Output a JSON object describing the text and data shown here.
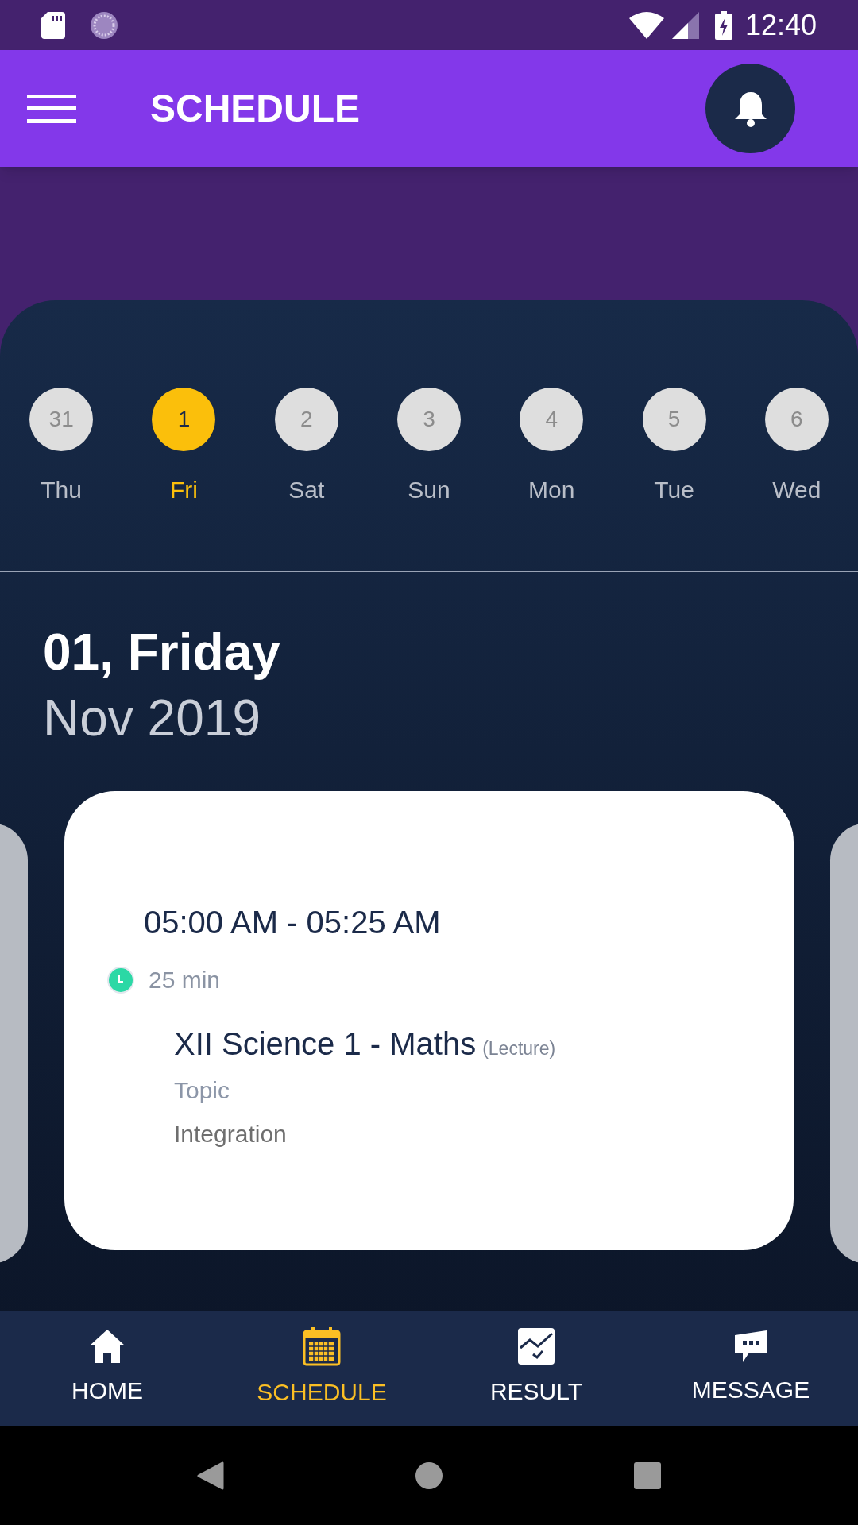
{
  "status_bar": {
    "time": "12:40"
  },
  "app_bar": {
    "title": "SCHEDULE"
  },
  "days": [
    {
      "number": "31",
      "weekday": "Thu",
      "selected": false
    },
    {
      "number": "1",
      "weekday": "Fri",
      "selected": true
    },
    {
      "number": "2",
      "weekday": "Sat",
      "selected": false
    },
    {
      "number": "3",
      "weekday": "Sun",
      "selected": false
    },
    {
      "number": "4",
      "weekday": "Mon",
      "selected": false
    },
    {
      "number": "5",
      "weekday": "Tue",
      "selected": false
    },
    {
      "number": "6",
      "weekday": "Wed",
      "selected": false
    }
  ],
  "date_heading": {
    "day": "01, Friday",
    "month_year": "Nov 2019"
  },
  "session": {
    "time_range": "05:00 AM - 05:25 AM",
    "duration": "25 min",
    "title": "XII Science 1 - Maths",
    "type": "(Lecture)",
    "topic_label": "Topic",
    "topic": "Integration"
  },
  "bottom_nav": [
    {
      "label": "HOME",
      "selected": false
    },
    {
      "label": "SCHEDULE",
      "selected": true
    },
    {
      "label": "RESULT",
      "selected": false
    },
    {
      "label": "MESSAGE",
      "selected": false
    }
  ]
}
